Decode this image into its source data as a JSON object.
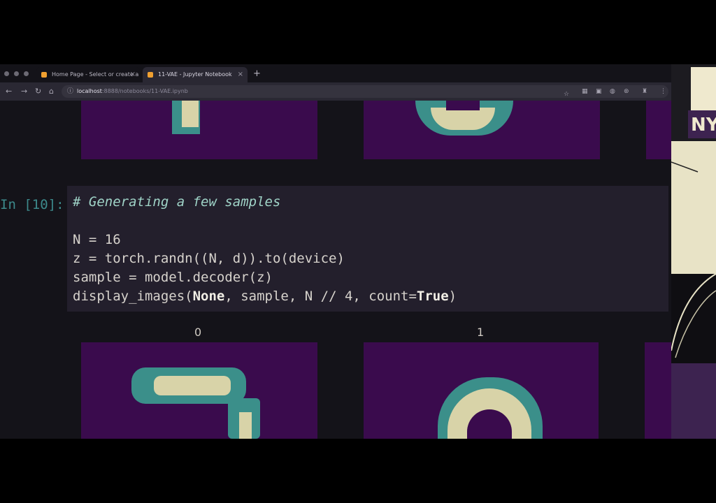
{
  "browser": {
    "tabs": [
      {
        "label": "Home Page - Select or create a",
        "active": false
      },
      {
        "label": "11-VAE - Jupyter Notebook",
        "active": true
      }
    ],
    "new_tab": "+",
    "tab_close": "×",
    "address": {
      "host": "localhost",
      "path": ":8888/notebooks/11-VAE.ipynb"
    }
  },
  "notebook": {
    "prompt": "In [10]:",
    "code": {
      "comment": "# Generating a few samples",
      "line_n": "N = 16",
      "line_z": "z = torch.randn((N, d)).to(device)",
      "line_sample": "sample = model.decoder(z)",
      "line_display_pre": "display_images(",
      "kw_none": "None",
      "line_display_mid": ", sample, N // 4, count=",
      "kw_true": "True",
      "line_display_post": ")"
    },
    "output_labels": [
      "0",
      "1"
    ]
  },
  "webcam": {
    "logo_text": "NY"
  },
  "colors": {
    "panel_purple": "#3a0b4d",
    "digit_teal": "#3b8f8a",
    "digit_cream": "#d8d3a8",
    "prompt_teal": "#3d8a8c",
    "comment_mint": "#9fd3c7"
  }
}
